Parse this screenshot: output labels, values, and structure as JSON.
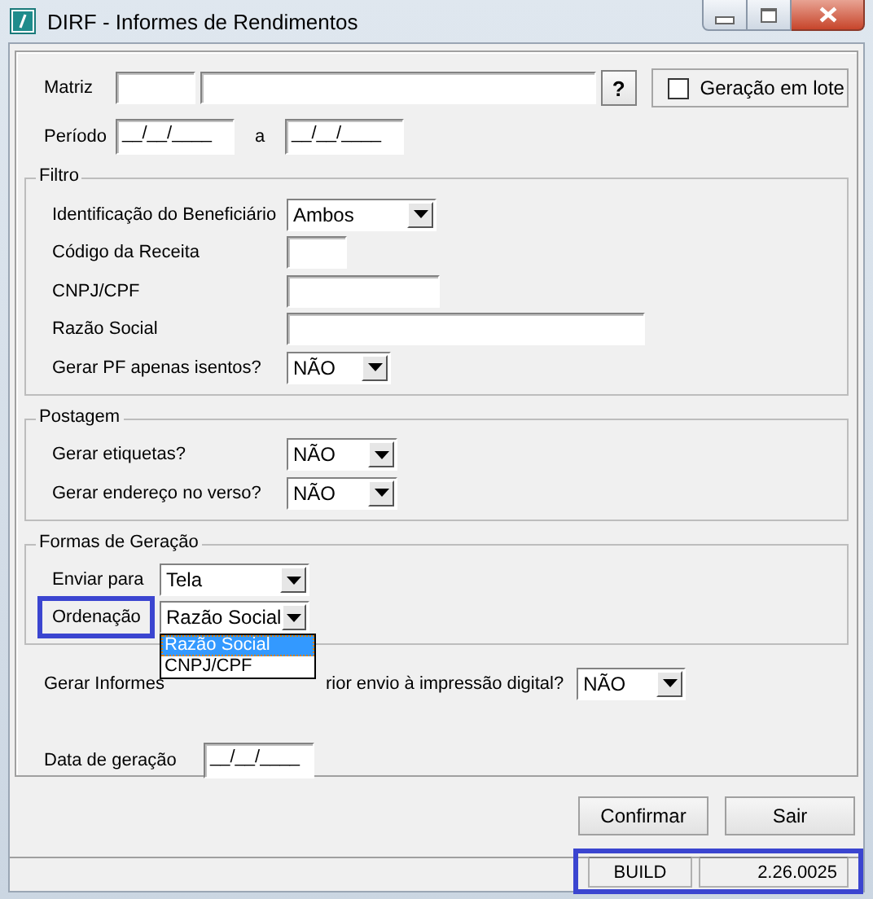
{
  "window": {
    "title": "DIRF - Informes de Rendimentos"
  },
  "header": {
    "matriz_label": "Matriz",
    "lookup_button": "?",
    "batch": {
      "label": "Geração em lote",
      "checked": false
    },
    "period": {
      "label": "Período",
      "from": "__/__/____",
      "separator": "a",
      "to": "__/__/____"
    }
  },
  "groups": [
    {
      "title": "Filtro",
      "fields": [
        {
          "kind": "select",
          "label": "Identificação do Beneficiário",
          "value": "Ambos"
        },
        {
          "kind": "input",
          "label": "Código da Receita"
        },
        {
          "kind": "input",
          "label": "CNPJ/CPF"
        },
        {
          "kind": "input",
          "label": "Razão Social"
        },
        {
          "kind": "select",
          "label": "Gerar PF apenas isentos?",
          "value": "NÃO"
        }
      ]
    },
    {
      "title": "Postagem",
      "fields": [
        {
          "kind": "select",
          "label": "Gerar etiquetas?",
          "value": "NÃO"
        },
        {
          "kind": "select",
          "label": "Gerar endereço no verso?",
          "value": "NÃO"
        }
      ]
    },
    {
      "title": "Formas de Geração",
      "fields": [
        {
          "kind": "select",
          "label": "Enviar para",
          "value": "Tela"
        },
        {
          "kind": "select",
          "label": "Ordenação",
          "value": "Razão Social",
          "highlighted": true,
          "open": true,
          "options": [
            {
              "label": "Razão Social",
              "selected": true
            },
            {
              "label": "CNPJ/CPF",
              "selected": false
            }
          ]
        }
      ]
    }
  ],
  "pdf_prompt": {
    "label_start": "Gerar Informes",
    "label_end": "rior envio à impressão digital?",
    "value": "NÃO"
  },
  "generation_date": {
    "label": "Data de geração",
    "value": "__/__/____"
  },
  "buttons": [
    {
      "label": "Confirmar"
    },
    {
      "label": "Sair"
    }
  ],
  "status_bar": {
    "highlighted": true,
    "cells": [
      "BUILD",
      "2.26.0025"
    ]
  }
}
